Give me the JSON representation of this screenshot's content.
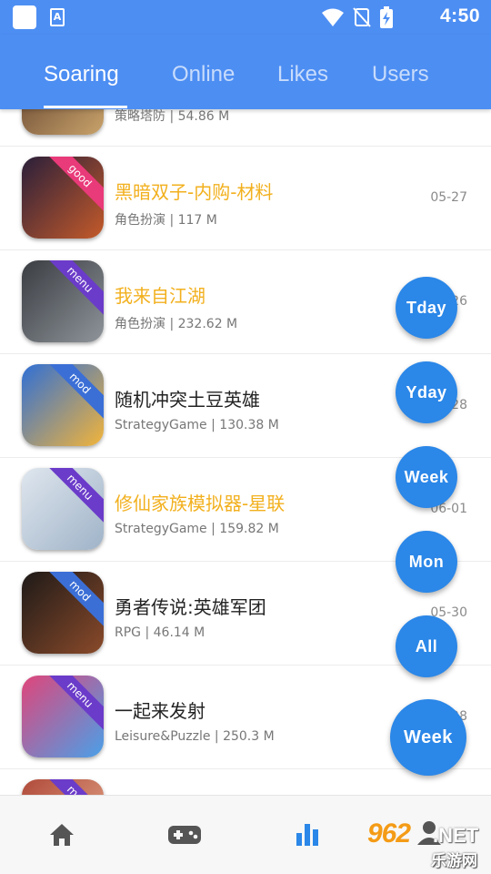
{
  "status_bar": {
    "a_badge": "A",
    "time": "4:50"
  },
  "tabs": [
    {
      "label": "Soaring",
      "active": true
    },
    {
      "label": "Online"
    },
    {
      "label": "Likes"
    },
    {
      "label": "Users"
    }
  ],
  "apps": [
    {
      "title": "",
      "meta": "策略塔防 | 54.86 M",
      "date": "",
      "badge": "",
      "highlight": false,
      "colors": [
        "#5a3a2a",
        "#c9a36b"
      ]
    },
    {
      "title": "黑暗双子-内购-材料",
      "meta": "角色扮演 | 117 M",
      "date": "05-27",
      "badge": "good",
      "highlight": true,
      "colors": [
        "#2a1f3a",
        "#c45a2a"
      ]
    },
    {
      "title": "我来自江湖",
      "meta": "角色扮演 | 232.62 M",
      "date": "06-26",
      "badge": "menu",
      "highlight": true,
      "colors": [
        "#3a3d42",
        "#8e949a"
      ]
    },
    {
      "title": "随机冲突土豆英雄",
      "meta": "StrategyGame | 130.38 M",
      "date": "05-28",
      "badge": "mod",
      "highlight": false,
      "colors": [
        "#2f6fd6",
        "#f2b43a"
      ]
    },
    {
      "title": "修仙家族模拟器-星联",
      "meta": "StrategyGame | 159.82 M",
      "date": "06-01",
      "badge": "menu",
      "highlight": true,
      "colors": [
        "#dfe6ee",
        "#9fb3c8"
      ]
    },
    {
      "title": "勇者传说:英雄军团",
      "meta": "RPG | 46.14 M",
      "date": "05-30",
      "badge": "mod",
      "highlight": false,
      "colors": [
        "#1e1a18",
        "#8a4a2a"
      ]
    },
    {
      "title": "一起来发射",
      "meta": "Leisure&Puzzle | 250.3 M",
      "date": "05-28",
      "badge": "menu",
      "highlight": false,
      "colors": [
        "#e0457a",
        "#4aa0e8"
      ]
    },
    {
      "title": "",
      "meta": "",
      "date": "",
      "badge": "menu",
      "highlight": false,
      "colors": [
        "#b04a3a",
        "#e8b090"
      ]
    }
  ],
  "fabs": [
    "Tday",
    "Yday",
    "Week",
    "Mon",
    "All",
    "Week"
  ],
  "bottom_nav": [
    {
      "icon": "home-icon"
    },
    {
      "icon": "gamepad-icon"
    },
    {
      "icon": "chart-icon",
      "active": true
    },
    {
      "icon": "user-icon"
    }
  ],
  "watermark": {
    "number": "962",
    "domain": ".NET",
    "text": "乐游网"
  },
  "colors": {
    "primary": "#4d8ef3",
    "fab": "#2b87e8",
    "highlight": "#f2b01e"
  }
}
